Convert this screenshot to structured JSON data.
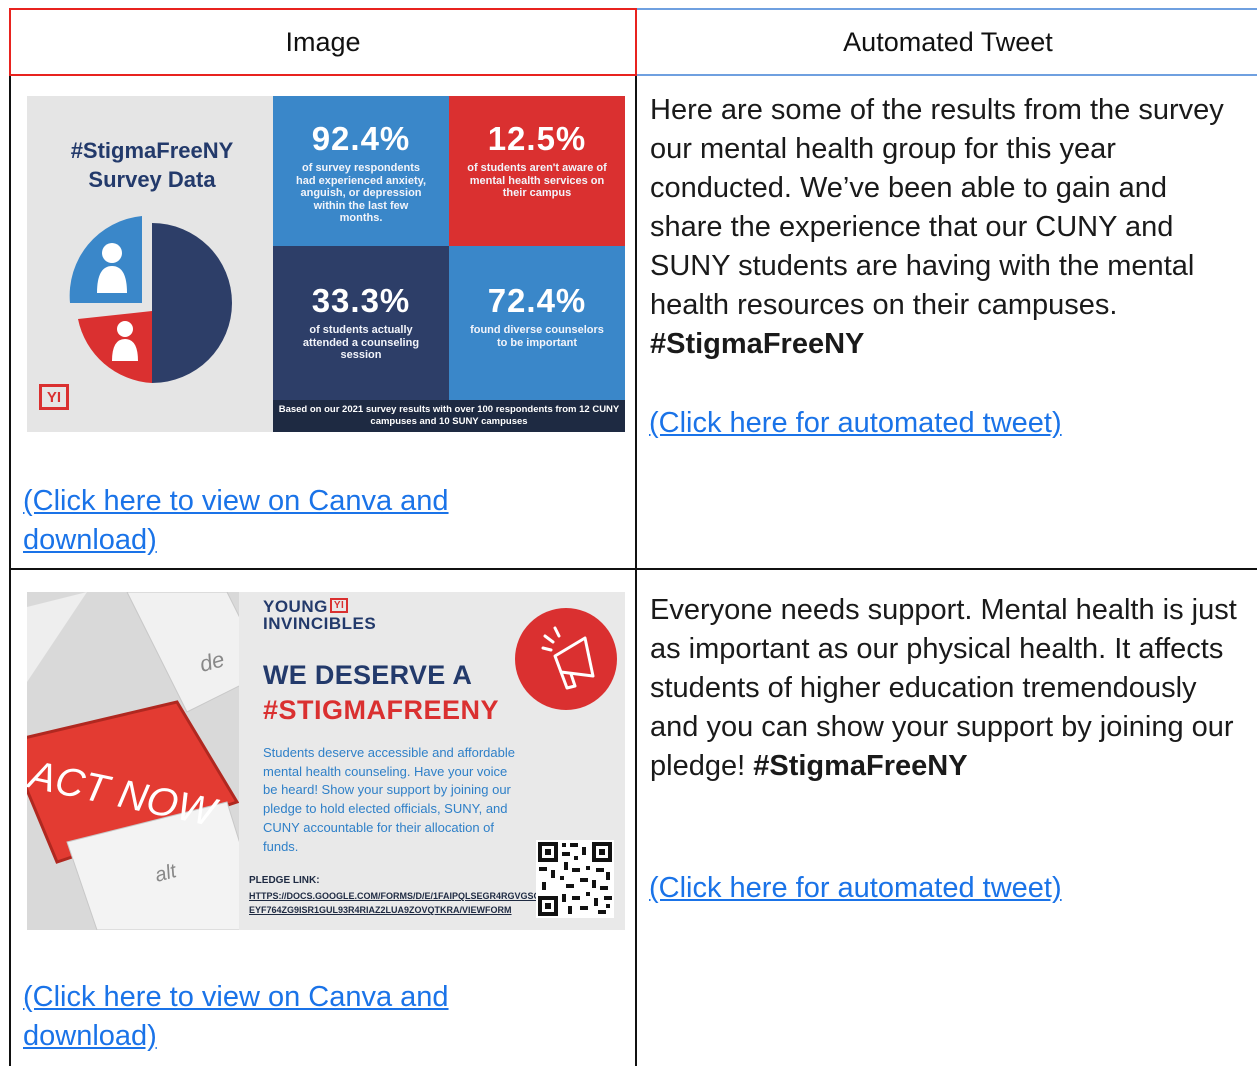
{
  "table": {
    "headers": [
      "Image",
      "Automated Tweet"
    ],
    "rows": [
      {
        "graphic": {
          "title": "#StigmaFreeNY Survey Data",
          "stats": [
            {
              "value": "92.4%",
              "text": "of survey respondents had experienced anxiety, anguish, or depression within the last few months.",
              "color": "#3a87c9"
            },
            {
              "value": "12.5%",
              "text": "of students aren't aware of mental health services on their campus",
              "color": "#da3030"
            },
            {
              "value": "33.3%",
              "text": "of students actually attended a counseling session",
              "color": "#2d3e68"
            },
            {
              "value": "72.4%",
              "text": "found diverse counselors to be important",
              "color": "#3a87c9"
            }
          ],
          "footnote": "Based on our 2021 survey results with over 100 respondents from 12 CUNY campuses and 10 SUNY campuses",
          "logo": "YI",
          "icons": [
            "pie-chart-icon",
            "person-icon"
          ]
        },
        "link": "(Click here to view on Canva and download)",
        "tweet": "Here are some of the results from the survey our mental health group for this year conducted. We’ve been able to gain and share the experience that our CUNY and SUNY students are having with the mental health resources on their campuses.",
        "hashtag": "#StigmaFreeNY",
        "tweet_link": "(Click here for automated tweet)"
      },
      {
        "graphic": {
          "keyboard_key": "ACT NOW",
          "key_letters": [
            "de",
            "alt"
          ],
          "org": "YOUNG",
          "org2": "INVINCIBLES",
          "logo": "YI",
          "heading1": "WE DESERVE A",
          "heading2": "#STIGMAFREENY",
          "body": "Students deserve accessible and affordable mental health counseling. Have your voice be heard! Show your support by joining our pledge to hold elected officials, SUNY, and CUNY accountable for their allocation of funds.",
          "pledge_label": "PLEDGE LINK:",
          "pledge_url": "HTTPS://DOCS.GOOGLE.COM/FORMS/D/E/1FAIPQLSEGR4RGVGSCYEYF764ZG9ISR1GUL93R4RIAZ2LUA9ZOVQTKRA/VIEWFORM",
          "icons": [
            "megaphone-icon",
            "qr-code-icon"
          ]
        },
        "link": "(Click here to view on Canva and download)",
        "tweet": "Everyone needs support. Mental health is just as important as our physical health. It affects students of higher education tremendously and you can show your support by joining our pledge!",
        "hashtag": "#StigmaFreeNY",
        "tweet_link": "(Click here for automated tweet)"
      }
    ]
  },
  "colors": {
    "link": "#1a73e8",
    "header_left_border": "#e8231f",
    "header_right_border": "#6fa0e0",
    "navy": "#233a6b",
    "red": "#da3030",
    "blue": "#3a87c9"
  }
}
